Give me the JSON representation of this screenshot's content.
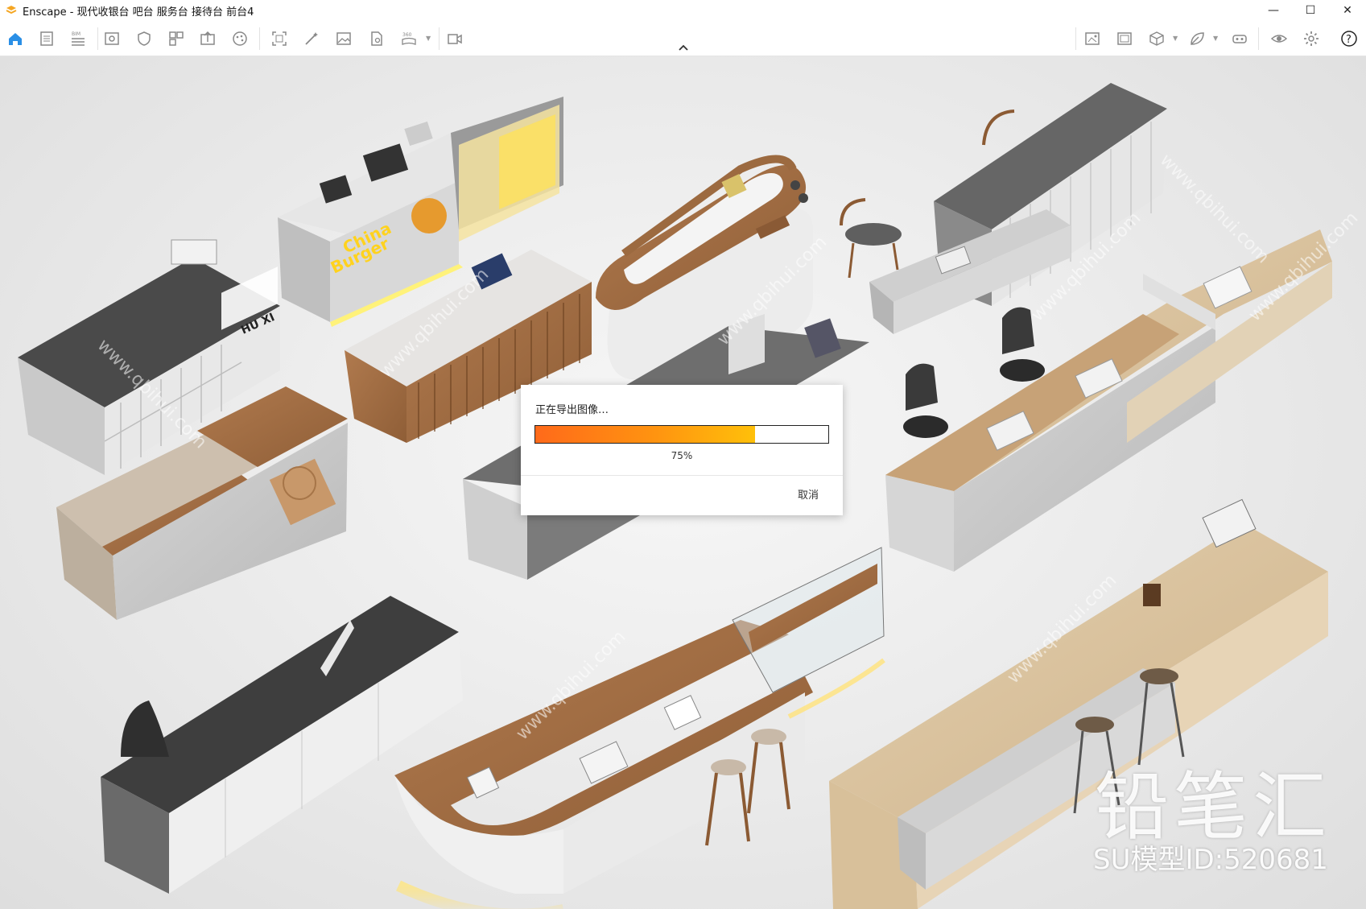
{
  "window": {
    "title": "Enscape - 现代收银台 吧台 服务台 接待台 前台4",
    "controls": {
      "minimize": "—",
      "maximize": "☐",
      "close": "✕"
    }
  },
  "toolbar": {
    "help": "?",
    "icons": [
      "home-icon",
      "document-icon",
      "bim-icon",
      "view-icon",
      "sync-icon",
      "assets-icon",
      "upload-icon",
      "palette-icon",
      "screenshot-icon",
      "magic-icon",
      "image-icon",
      "file-settings-icon",
      "panorama-icon",
      "video-icon",
      "batch-render-icon",
      "gallery-icon",
      "cube-icon",
      "leaf-icon",
      "vr-icon",
      "eye-icon",
      "settings-icon",
      "help-icon"
    ]
  },
  "dialog": {
    "title": "正在导出图像…",
    "progress": 0.75,
    "progress_label": "75%",
    "cancel_label": "取消"
  },
  "scene": {
    "sign_china_burger_line1": "China",
    "sign_china_burger_line2": "Burger",
    "sign_huxi": "HU XI",
    "watermark_logo": "铅笔汇",
    "watermark_id": "SU模型ID:520681",
    "watermark_url": "www.qbihui.com"
  }
}
